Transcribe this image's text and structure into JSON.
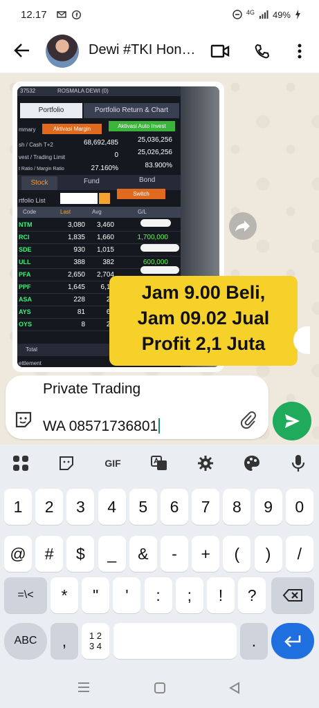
{
  "status_bar": {
    "time": "12.17",
    "network": "4G",
    "battery": "49%"
  },
  "header": {
    "contact_name": "Dewi #TKI Hon…"
  },
  "message_image": {
    "screen": {
      "account_id": "37532",
      "account_name": "ROSMALA DEWI (0)",
      "tab_portfolio": "Portfolio",
      "tab_return": "Portfolio Return & Chart",
      "summary_label": "mmary",
      "btn_margin": "Aktivasi Margin",
      "btn_auto": "Aktivasi Auto Invest",
      "rows": [
        {
          "label": "sh / Cash T+2",
          "v1": "68,692,485",
          "v2": "25,036,256"
        },
        {
          "label": "vest / Trading Limit",
          "v1": "0",
          "v2": "25,026,256"
        },
        {
          "label": "t Ratio / Margin Ratio",
          "v1": "27.160%",
          "v2": "83.900%"
        }
      ],
      "tab_stock": "Stock",
      "tab_fund": "Fund",
      "tab_bond": "Bond",
      "portfolio_list": "rtfolio List",
      "switch_label": "Switch",
      "col_code": "Code",
      "col_last": "Last",
      "col_avg": "Avg",
      "col_gl": "G/L",
      "stocks": [
        {
          "code": "NTM",
          "last": "3,080",
          "avg": "3,460",
          "gl": ""
        },
        {
          "code": "RCI",
          "last": "1,835",
          "avg": "1,660",
          "gl": "1,700,000"
        },
        {
          "code": "SDE",
          "last": "930",
          "avg": "1,015",
          "gl": ""
        },
        {
          "code": "ULL",
          "last": "388",
          "avg": "382",
          "gl": "600,000"
        },
        {
          "code": "PFA",
          "last": "2,650",
          "avg": "2,704",
          "gl": ""
        },
        {
          "code": "PPF",
          "last": "1,645",
          "avg": "6,18",
          "gl": ""
        },
        {
          "code": "ASA",
          "last": "228",
          "avg": "24",
          "gl": ""
        },
        {
          "code": "AYS",
          "last": "81",
          "avg": "60",
          "gl": ""
        },
        {
          "code": "OYS",
          "last": "8",
          "avg": "29",
          "gl": ""
        }
      ],
      "total_label": "Total",
      "settlement_label": "ettlement"
    },
    "overlay_lines": [
      "Jam 9.00 Beli,",
      "Jam 09.02 Jual",
      "Profit 2,1 Juta"
    ]
  },
  "compose": {
    "line1": "Private Trading",
    "line2": "WA 08571736801"
  },
  "keyboard": {
    "toolbar": {
      "gif": "GIF"
    },
    "row1": [
      "1",
      "2",
      "3",
      "4",
      "5",
      "6",
      "7",
      "8",
      "9",
      "0"
    ],
    "row2": [
      "@",
      "#",
      "$",
      "_",
      "&",
      "-",
      "+",
      "(",
      ")",
      "/"
    ],
    "row3": [
      "=\\<",
      "*",
      "\"",
      "'",
      ":",
      ";",
      "!",
      "?"
    ],
    "row4": {
      "abc": "ABC",
      "comma": ",",
      "num_top": "1 2",
      "num_bottom": "3 4",
      "period": "."
    }
  },
  "colors": {
    "send_button": "#1fab5b",
    "enter_key": "#1f6fe0",
    "overlay_yellow": "#f6d12a"
  }
}
